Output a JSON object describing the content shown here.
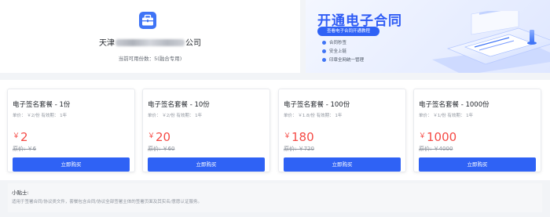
{
  "company": {
    "name_prefix": "天津",
    "name_suffix": "公司",
    "available_label": "当前可用份数：5(融合专用)"
  },
  "banner": {
    "title": "开通电子合同",
    "subtitle": "查看电子合同开通教程",
    "features": [
      "合同秒签",
      "安全上链",
      "印章全网统一管理"
    ]
  },
  "packages": [
    {
      "title": "电子签名套餐 - 1份",
      "meta": "单价： ￥2/份    有效期： 1年",
      "currency": "￥",
      "price": "2",
      "original": "原价: ￥6",
      "button": "立即购买"
    },
    {
      "title": "电子签名套餐 - 10份",
      "meta": "单价： ￥2/份    有效期： 1年",
      "currency": "￥",
      "price": "20",
      "original": "原价: ￥60",
      "button": "立即购买"
    },
    {
      "title": "电子签名套餐 - 100份",
      "meta": "单价： ￥1.8/份    有效期： 1年",
      "currency": "￥",
      "price": "180",
      "original": "原价: ￥720",
      "button": "立即购买"
    },
    {
      "title": "电子签名套餐 - 1000份",
      "meta": "单价： ￥1/份    有效期： 1年",
      "currency": "￥",
      "price": "1000",
      "original": "原价: ￥4000",
      "button": "立即购买"
    }
  ],
  "tips": {
    "title": "小贴士:",
    "text": "适用于签署合同/协议类文件，套餐包含合同/协议全部签署主体的签署页面及其实名/意愿认证服务。"
  },
  "colors": {
    "primary": "#2f62f5",
    "price": "#f54a45",
    "page_bg": "#f2f4f7"
  },
  "icons": {
    "company": "briefcase-icon"
  }
}
